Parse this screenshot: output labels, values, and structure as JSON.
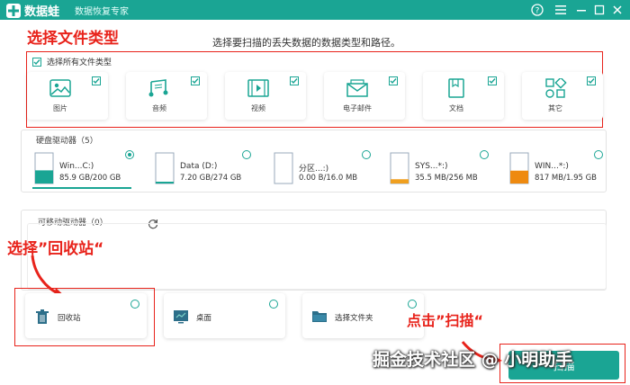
{
  "app": {
    "name": "数据蛙",
    "subtitle": "数据恢复专家"
  },
  "annotations": {
    "select_types": "选择文件类型",
    "select_recycle": "选择”回收站“",
    "click_scan": "点击”扫描“"
  },
  "instruction": "选择要扫描的丢失数据的数据类型和路径。",
  "file_types": {
    "select_all_label": "选择所有文件类型",
    "items": [
      {
        "label": "图片",
        "icon": "image-icon",
        "checked": true
      },
      {
        "label": "音频",
        "icon": "audio-icon",
        "checked": true
      },
      {
        "label": "视频",
        "icon": "video-icon",
        "checked": true
      },
      {
        "label": "电子邮件",
        "icon": "email-icon",
        "checked": true
      },
      {
        "label": "文档",
        "icon": "document-icon",
        "checked": true
      },
      {
        "label": "其它",
        "icon": "other-icon",
        "checked": true
      }
    ]
  },
  "hard_drives": {
    "title": "硬盘驱动器（5）",
    "items": [
      {
        "name": "Win...C:)",
        "size": "85.9 GB/200 GB",
        "fill": 0.43,
        "color": "#1aa594",
        "selected": true
      },
      {
        "name": "Data (D:)",
        "size": "7.20 GB/274 GB",
        "fill": 0.03,
        "color": "#1aa594",
        "selected": false
      },
      {
        "name": "分区...:)",
        "size": "0.00  B/16.0 MB",
        "fill": 0.0,
        "color": "#f0a020",
        "selected": false
      },
      {
        "name": "SYS...*:)",
        "size": "35.5 MB/256 MB",
        "fill": 0.14,
        "color": "#f0a020",
        "selected": false
      },
      {
        "name": "WIN...*:)",
        "size": "817 MB/1.95 GB",
        "fill": 0.42,
        "color": "#ee8a10",
        "selected": false
      }
    ]
  },
  "removable": {
    "title": "可移动驱动器（0）"
  },
  "locations": [
    {
      "label": "回收站",
      "icon": "trash-icon"
    },
    {
      "label": "桌面",
      "icon": "desktop-icon"
    },
    {
      "label": "选择文件夹",
      "icon": "folder-icon"
    }
  ],
  "scan_button": "扫描",
  "watermark": "掘金技术社区 @ 小明助手",
  "colors": {
    "accent": "#1aa594",
    "annotation": "#e8231b"
  }
}
